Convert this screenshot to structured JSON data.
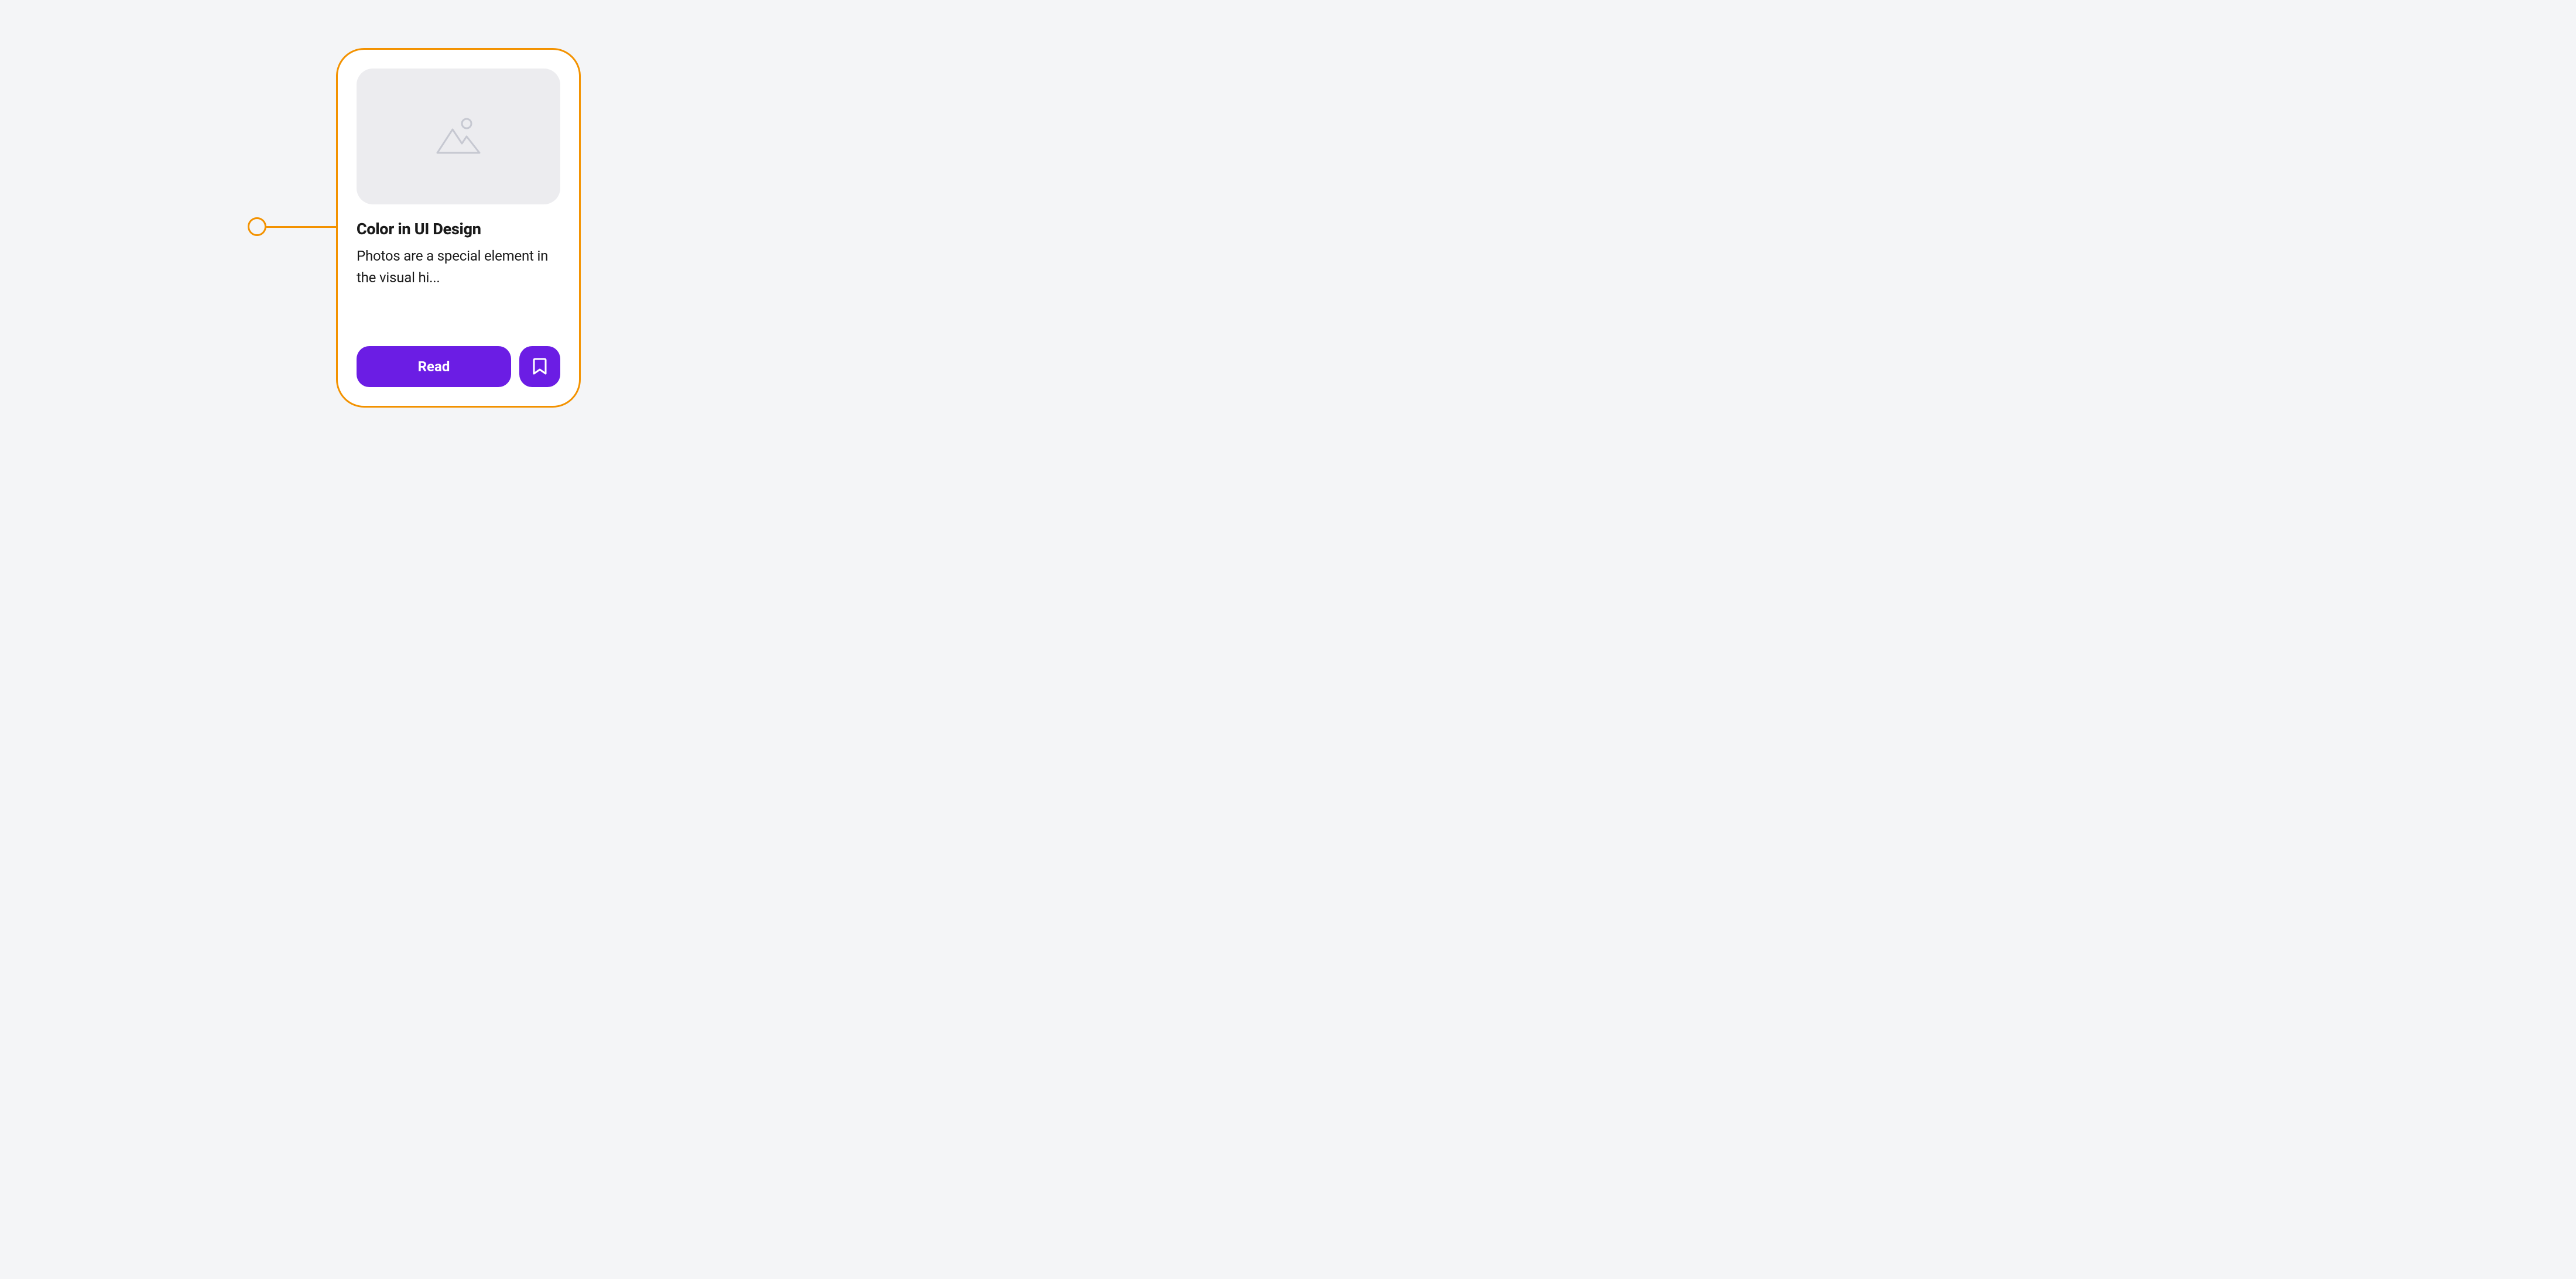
{
  "card": {
    "title": "Color in UI Design",
    "description": "Photos are a special element in the visual hi...",
    "read_label": "Read"
  },
  "colors": {
    "highlight": "#f39200",
    "primary": "#6b1de4",
    "placeholder_bg": "#ececef",
    "placeholder_stroke": "#c6c8d1"
  }
}
